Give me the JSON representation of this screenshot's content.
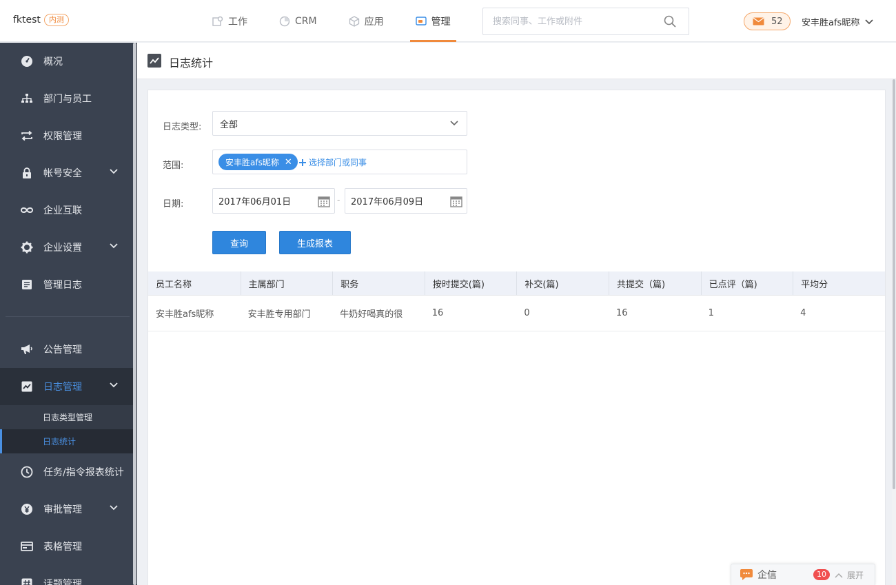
{
  "brand": {
    "name": "fktest",
    "badge": "内测"
  },
  "nav": [
    {
      "label": "工作",
      "icon": "work-icon"
    },
    {
      "label": "CRM",
      "icon": "crm-icon"
    },
    {
      "label": "应用",
      "icon": "app-icon"
    },
    {
      "label": "管理",
      "icon": "admin-icon",
      "active": true
    }
  ],
  "search": {
    "placeholder": "搜索同事、工作或附件"
  },
  "messages": {
    "count": "52"
  },
  "user": {
    "name": "安丰胜afs昵称"
  },
  "sidebar": {
    "items": [
      {
        "label": "概况"
      },
      {
        "label": "部门与员工"
      },
      {
        "label": "权限管理"
      },
      {
        "label": "帐号安全"
      },
      {
        "label": "企业互联"
      },
      {
        "label": "企业设置"
      },
      {
        "label": "管理日志"
      },
      {
        "label": "公告管理"
      },
      {
        "label": "日志管理"
      },
      {
        "label": "任务/指令报表统计"
      },
      {
        "label": "审批管理"
      },
      {
        "label": "表格管理"
      },
      {
        "label": "话题管理"
      }
    ],
    "sub_items": [
      {
        "label": "日志类型管理"
      },
      {
        "label": "日志统计"
      }
    ]
  },
  "page": {
    "title": "日志统计"
  },
  "form": {
    "type_label": "日志类型:",
    "type_value": "全部",
    "range_label": "范围:",
    "range_tag": "安丰胜afs昵称",
    "range_add": "选择部门或同事",
    "date_label": "日期:",
    "date_from": "2017年06月01日",
    "date_to": "2017年06月09日",
    "date_sep": "-",
    "query_button": "查询",
    "report_button": "生成报表"
  },
  "table": {
    "headers": [
      "员工名称",
      "主属部门",
      "职务",
      "按时提交(篇)",
      "补交(篇)",
      "共提交（篇)",
      "已点评（篇)",
      "平均分"
    ],
    "rows": [
      [
        "安丰胜afs昵称",
        "安丰胜专用部门",
        "牛奶好喝真的很",
        "16",
        "0",
        "16",
        "1",
        "4"
      ]
    ]
  },
  "chat": {
    "title": "企信",
    "count": "10",
    "expand": "展开"
  },
  "colors": {
    "accent": "#f08a3c",
    "primary": "#2f86dd",
    "sidebar": "#3a4250"
  }
}
